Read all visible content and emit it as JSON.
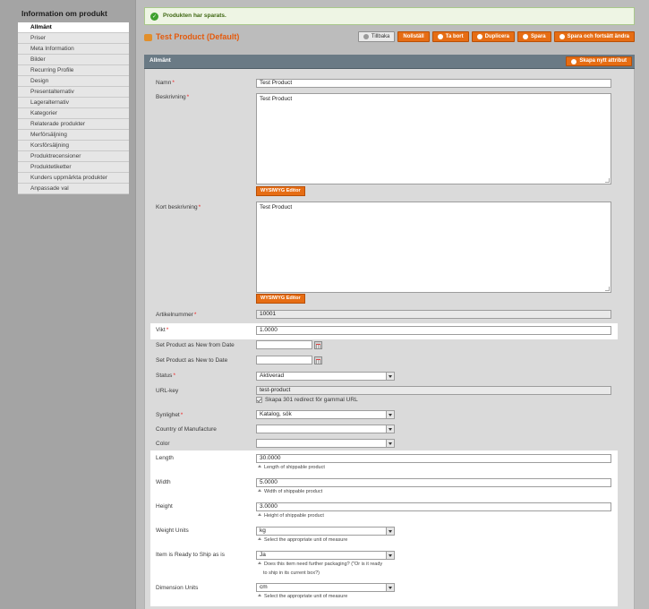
{
  "sidebar": {
    "title": "Information om produkt",
    "items": [
      {
        "label": "Allmänt",
        "active": true
      },
      {
        "label": "Priser"
      },
      {
        "label": "Meta Information"
      },
      {
        "label": "Bilder"
      },
      {
        "label": "Recurring Profile"
      },
      {
        "label": "Design"
      },
      {
        "label": "Presentalternativ"
      },
      {
        "label": "Lageralternativ"
      },
      {
        "label": "Kategorier"
      },
      {
        "label": "Relaterade produkter"
      },
      {
        "label": "Merförsäljning"
      },
      {
        "label": "Korsförsäljning"
      },
      {
        "label": "Produktrecensioner"
      },
      {
        "label": "Produktetiketter"
      },
      {
        "label": "Kunders uppmärkta produkter"
      },
      {
        "label": "Anpassade val"
      }
    ]
  },
  "message": "Produkten har sparats.",
  "header": {
    "title": "Test Product (Default)",
    "buttons": {
      "back": "Tillbaka",
      "reset": "Nollställ",
      "delete": "Ta bort",
      "duplicate": "Duplicera",
      "save": "Spara",
      "save_continue": "Spara och fortsätt ändra"
    }
  },
  "section": {
    "title": "Allmänt",
    "create_attribute": "Skapa nytt attribut"
  },
  "fields": {
    "name": {
      "label": "Namn",
      "value": "Test Product"
    },
    "description": {
      "label": "Beskrivning",
      "value": "Test Product"
    },
    "wysiwyg": "WYSIWYG Editor",
    "short_description": {
      "label": "Kort beskrivning",
      "value": "Test Product"
    },
    "sku": {
      "label": "Artikelnummer",
      "value": "10001"
    },
    "weight": {
      "label": "Vikt",
      "value": "1.0000"
    },
    "new_from": {
      "label": "Set Product as New from Date",
      "value": ""
    },
    "new_to": {
      "label": "Set Product as New to Date",
      "value": ""
    },
    "status": {
      "label": "Status",
      "value": "Aktiverad"
    },
    "url_key": {
      "label": "URL-key",
      "value": "test-product",
      "redirect": "Skapa 301 redirect för gammal URL"
    },
    "visibility": {
      "label": "Synlighet",
      "value": "Katalog, sök"
    },
    "country": {
      "label": "Country of Manufacture",
      "value": ""
    },
    "color": {
      "label": "Color",
      "value": ""
    },
    "length": {
      "label": "Length",
      "value": "30.0000",
      "note": "Length of shippable product"
    },
    "width": {
      "label": "Width",
      "value": "5.0000",
      "note": "Width of shippable product"
    },
    "height": {
      "label": "Height",
      "value": "3.0000",
      "note": "Height of shippable product"
    },
    "weight_units": {
      "label": "Weight Units",
      "value": "kg",
      "note": "Select the appropriate unit of measure"
    },
    "ready_to_ship": {
      "label": "Item is Ready to Ship as is",
      "value": "Ja",
      "note_line1": "Does this item need further packaging? (\"Or is it ready",
      "note_line2": "to ship in its current box?)"
    },
    "dimension_units": {
      "label": "Dimension Units",
      "value": "cm",
      "note": "Select the appropriate unit of measure"
    }
  },
  "colors": {
    "accent": "#e66d14",
    "section_bar": "#6a7a85",
    "title": "#e45a0c",
    "success": "#3fa12e"
  }
}
